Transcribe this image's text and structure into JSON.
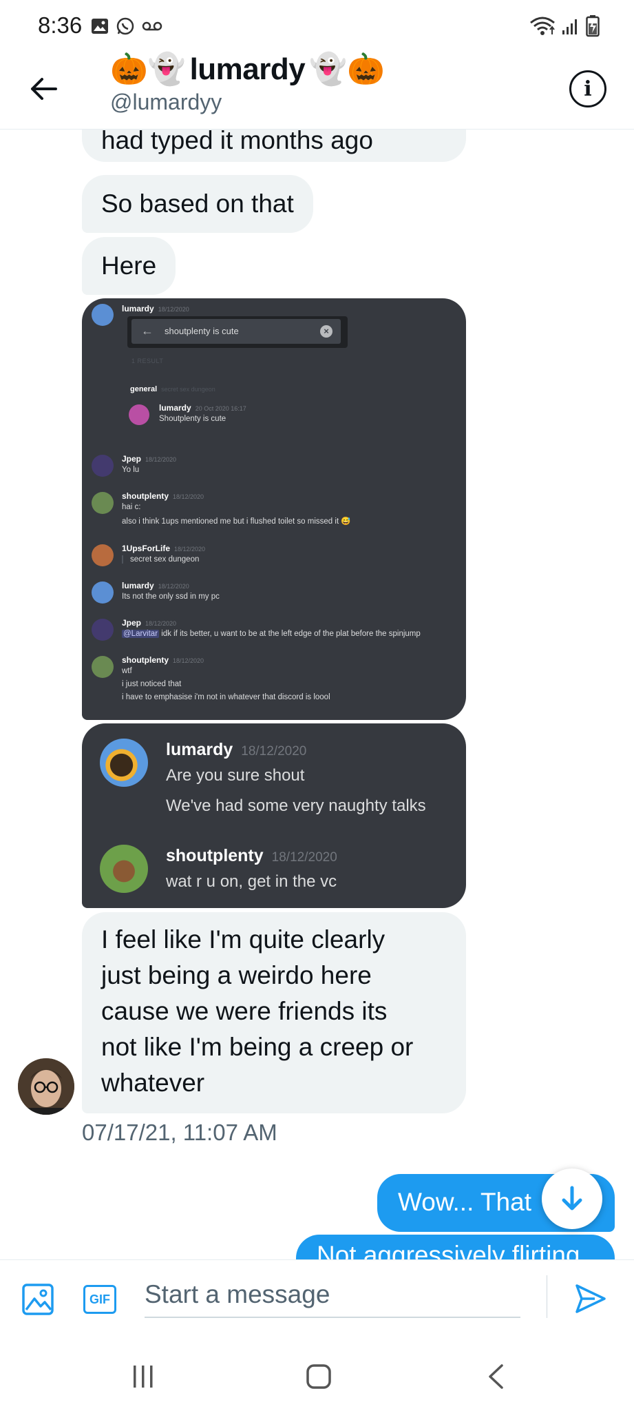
{
  "status_bar": {
    "time": "8:36"
  },
  "header": {
    "display_name": "lumardy",
    "emoji_left": "🎃👻",
    "emoji_right": "👻🎃",
    "handle": "@lumardyy"
  },
  "messages": {
    "received": [
      "had typed it months ago",
      "So based on that",
      "Here"
    ],
    "long_received": [
      "I feel like I'm quite clearly",
      "just being a weirdo here",
      "cause we were friends its",
      "not like I'm being a creep or",
      "whatever"
    ],
    "timestamp": "07/17/21, 11:07 AM",
    "sent": [
      "Wow... That",
      "Not aggressively flirting"
    ]
  },
  "discord1": {
    "search_query": "shoutplenty is cute",
    "result_label": "1 RESULT",
    "channel": "general",
    "channel_topic": "secret sex dungeon",
    "search_result": {
      "user": "lumardy",
      "time": "20 Oct 2020 16:17",
      "text": "Shoutplenty is cute"
    },
    "top_user": {
      "name": "lumardy",
      "time": "18/12/2020"
    },
    "messages": [
      {
        "name": "Jpep",
        "time": "18/12/2020",
        "lines": [
          "Yo lu"
        ]
      },
      {
        "name": "shoutplenty",
        "time": "18/12/2020",
        "lines": [
          "hai c:",
          "also i think 1ups mentioned me but i flushed toilet so missed it 😅"
        ]
      },
      {
        "name": "1UpsForLife",
        "time": "18/12/2020",
        "lines": [
          "secret sex dungeon"
        ]
      },
      {
        "name": "lumardy",
        "time": "18/12/2020",
        "lines": [
          "Its not the only ssd in my pc"
        ]
      },
      {
        "name": "Jpep",
        "time": "18/12/2020",
        "mention": "@Larvitar",
        "lines": [
          "idk if its better, u want  to be at the left edge of the plat before the spinjump"
        ]
      },
      {
        "name": "shoutplenty",
        "time": "18/12/2020",
        "lines": [
          "wtf",
          "i just noticed that",
          "i have to emphasise i'm not in whatever that discord is loool"
        ]
      }
    ]
  },
  "discord2": {
    "messages": [
      {
        "name": "lumardy",
        "time": "18/12/2020",
        "lines": [
          "Are you sure shout",
          "We've had some very naughty talks"
        ]
      },
      {
        "name": "shoutplenty",
        "time": "18/12/2020",
        "lines": [
          "wat r u on, get in the vc"
        ]
      }
    ]
  },
  "composer": {
    "placeholder": "Start a message",
    "gif_label": "GIF"
  },
  "colors": {
    "accent": "#1d9bf0",
    "bubble_received": "#eff3f4",
    "discord_bg": "#36393f"
  }
}
